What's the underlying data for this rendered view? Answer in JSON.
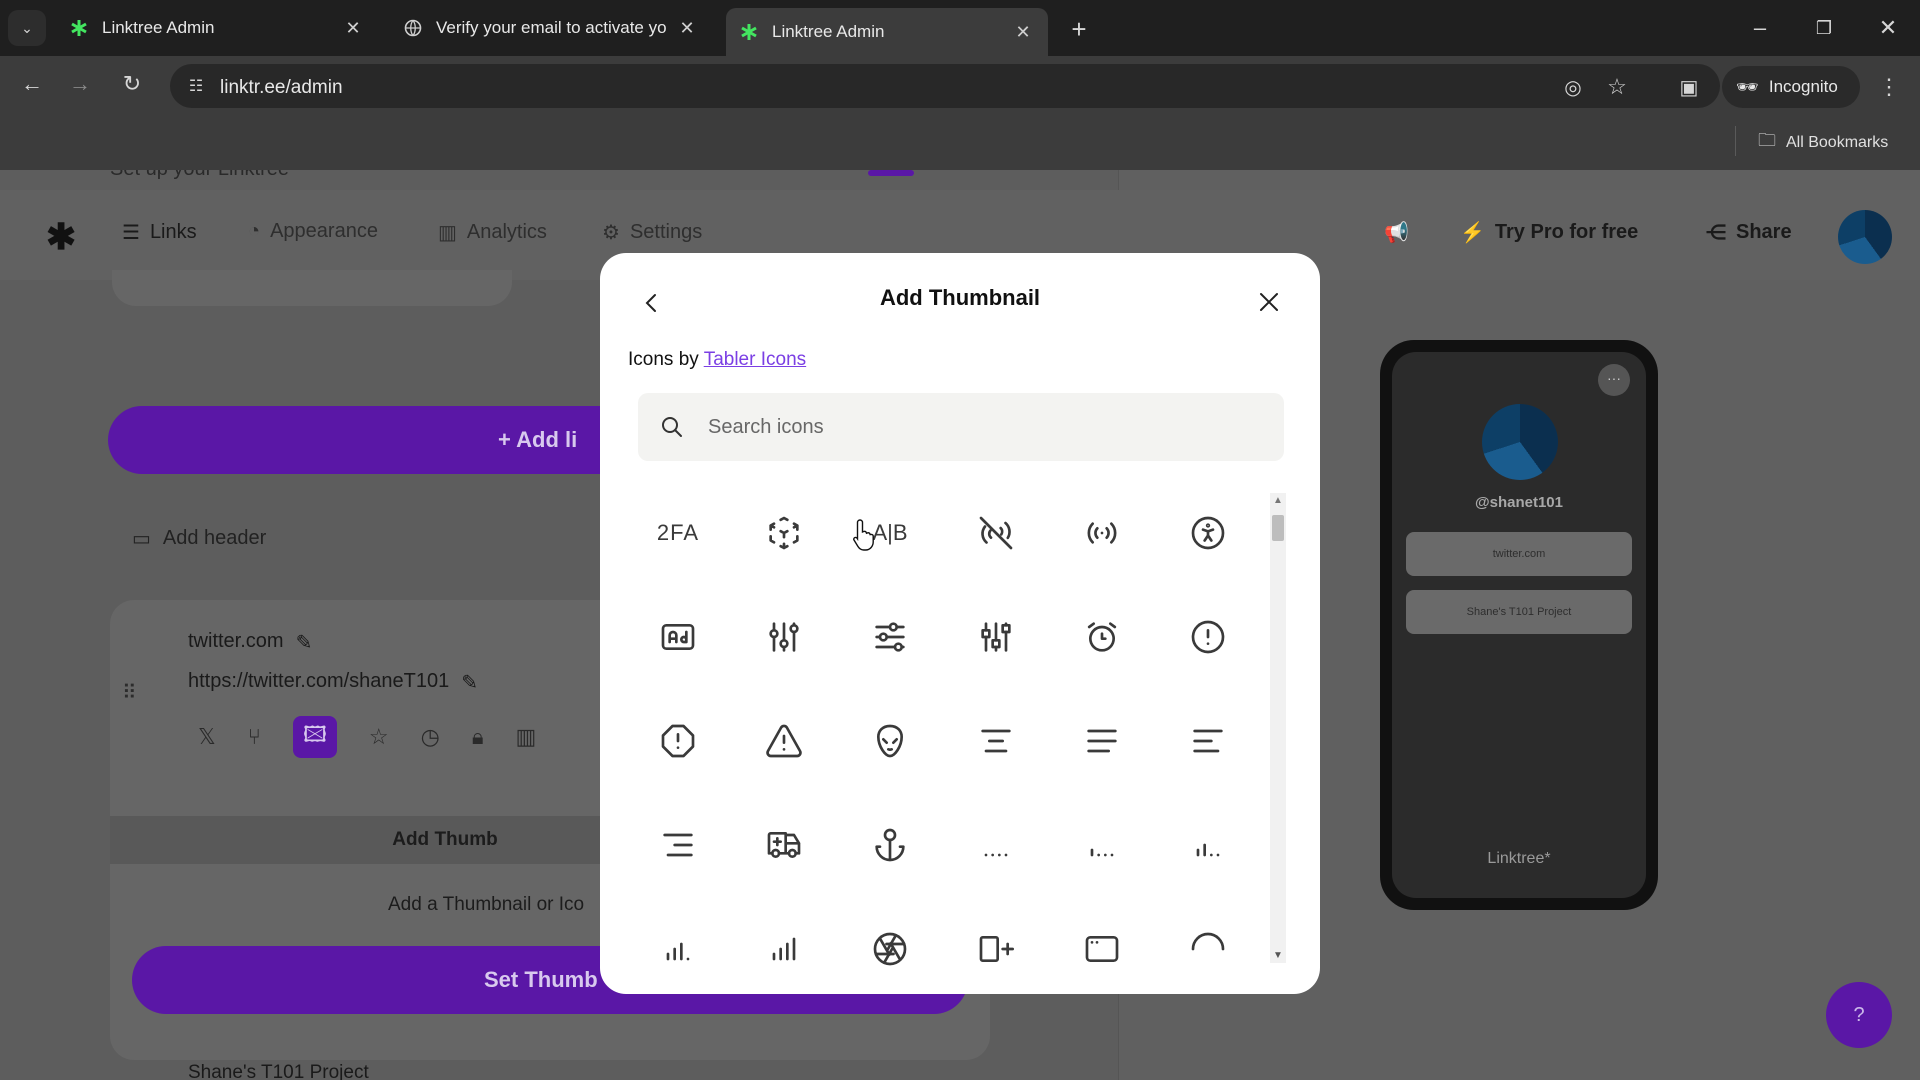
{
  "browser": {
    "tabs": [
      {
        "title": "Linktree Admin",
        "active": false
      },
      {
        "title": "Verify your email to activate yo",
        "active": false
      },
      {
        "title": "Linktree Admin",
        "active": true
      }
    ],
    "url": "linktr.ee/admin",
    "incognito_label": "Incognito",
    "bookmarks_label": "All Bookmarks"
  },
  "app": {
    "setup_banner": "Set up your Linktree",
    "nav": {
      "links": "Links",
      "appearance": "Appearance",
      "analytics": "Analytics",
      "settings": "Settings",
      "try_pro": "Try Pro for free",
      "share": "Share"
    },
    "add_link_label": "+ Add li",
    "add_header_label": "Add header",
    "link": {
      "title": "twitter.com",
      "url": "https://twitter.com/shaneT101"
    },
    "thumbnail_panel": {
      "title": "Add Thumb",
      "description": "Add a Thumbnail or Ico",
      "button": "Set Thumb"
    },
    "next_link_title": "Shane's T101 Project",
    "preview": {
      "handle": "@shanet101",
      "links": [
        "twitter.com",
        "Shane's T101 Project"
      ],
      "brand": "Linktree*"
    },
    "help_label": "?"
  },
  "modal": {
    "title": "Add Thumbnail",
    "credits_prefix": "Icons by",
    "credits_link": "Tabler Icons",
    "search_placeholder": "Search icons",
    "icons": [
      "2fa-icon",
      "3d-cube-sphere-icon",
      "a-b-icon",
      "access-point-off-icon",
      "access-point-icon",
      "accessible-icon",
      "ad-icon",
      "adjustments-icon",
      "adjustments-horizontal-icon",
      "adjustments-alt-icon",
      "alarm-icon",
      "alert-circle-icon",
      "alert-octagon-icon",
      "alert-triangle-icon",
      "alien-icon",
      "align-center-icon",
      "align-justified-icon",
      "align-left-icon",
      "align-right-icon",
      "ambulance-icon",
      "anchor-icon",
      "antenna-bars-1-icon",
      "antenna-bars-2-icon",
      "antenna-bars-3-icon",
      "antenna-bars-4-icon",
      "antenna-bars-5-icon",
      "aperture-icon",
      "app-window-plus-icon",
      "app-window-icon",
      "arc-icon"
    ]
  }
}
